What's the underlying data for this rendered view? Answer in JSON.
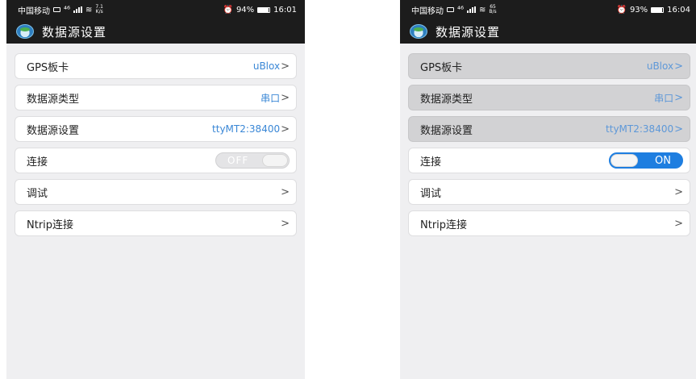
{
  "left": {
    "status": {
      "carrier": "中国移动",
      "net": "⁴⁶",
      "speed_value": "7.1",
      "speed_unit": "K/s",
      "battery_pct": "94%",
      "battery_level": 0.94,
      "time": "16:01"
    },
    "appbar": {
      "title": "数据源设置"
    },
    "rows": {
      "gps": {
        "label": "GPS板卡",
        "value": "uBlox"
      },
      "type": {
        "label": "数据源类型",
        "value": "串口"
      },
      "settings": {
        "label": "数据源设置",
        "value": "ttyMT2:38400"
      },
      "connect": {
        "label": "连接",
        "toggle": "OFF",
        "enabled": false
      },
      "debug": {
        "label": "调试"
      },
      "ntrip": {
        "label": "Ntrip连接"
      }
    }
  },
  "right": {
    "status": {
      "carrier": "中国移动",
      "net": "⁴⁶",
      "speed_value": "65",
      "speed_unit": "B/s",
      "battery_pct": "93%",
      "battery_level": 0.93,
      "time": "16:04"
    },
    "appbar": {
      "title": "数据源设置"
    },
    "rows": {
      "gps": {
        "label": "GPS板卡",
        "value": "uBlox"
      },
      "type": {
        "label": "数据源类型",
        "value": "串口"
      },
      "settings": {
        "label": "数据源设置",
        "value": "ttyMT2:38400"
      },
      "connect": {
        "label": "连接",
        "toggle": "ON",
        "enabled": true
      },
      "debug": {
        "label": "调试"
      },
      "ntrip": {
        "label": "Ntrip连接"
      }
    }
  },
  "icons": {
    "chevron": "chevron-right-icon",
    "app": "app-globe-icon"
  },
  "colors": {
    "accent": "#1e7ee0",
    "value_text": "#3a87d6",
    "appbar": "#1c1c1c",
    "background": "#efeff1",
    "disabled_row": "#d2d2d4"
  }
}
